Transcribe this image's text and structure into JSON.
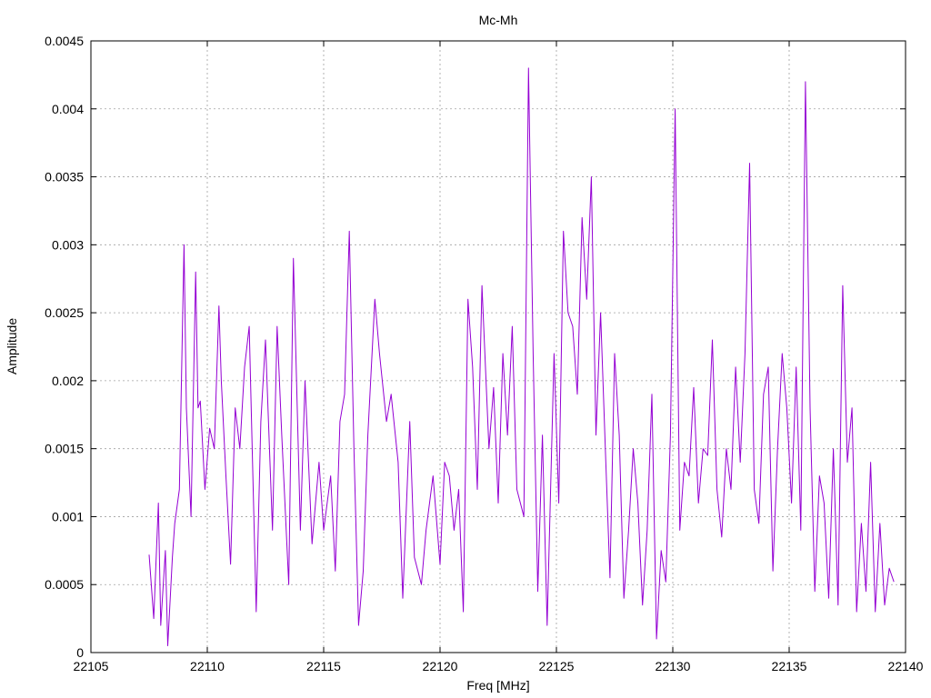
{
  "chart_data": {
    "type": "line",
    "title": "Mc-Mh",
    "xlabel": "Freq [MHz]",
    "ylabel": "Amplitude",
    "xlim": [
      22105,
      22140
    ],
    "ylim": [
      0,
      0.0045
    ],
    "xticks": [
      22105,
      22110,
      22115,
      22120,
      22125,
      22130,
      22135,
      22140
    ],
    "xtick_labels": [
      "22105",
      "22110",
      "22115",
      "22120",
      "22125",
      "22130",
      "22135",
      "22140"
    ],
    "yticks": [
      0,
      0.0005,
      0.001,
      0.0015,
      0.002,
      0.0025,
      0.003,
      0.0035,
      0.004,
      0.0045
    ],
    "ytick_labels": [
      "0",
      "0.0005",
      "0.001",
      "0.0015",
      "0.002",
      "0.0025",
      "0.003",
      "0.0035",
      "0.004",
      "0.0045"
    ],
    "grid": true,
    "color": "#9400d3",
    "series": [
      {
        "x": [
          22107.5,
          22107.7,
          22107.9,
          22108.0,
          22108.2,
          22108.3,
          22108.5,
          22108.6,
          22108.8,
          22109.0,
          22109.1,
          22109.3,
          22109.5,
          22109.6,
          22109.7,
          22109.9,
          22110.1,
          22110.3,
          22110.5,
          22110.6,
          22110.8,
          22111.0,
          22111.2,
          22111.4,
          22111.6,
          22111.8,
          22112.1,
          22112.3,
          22112.5,
          22112.8,
          22113.0,
          22113.2,
          22113.5,
          22113.7,
          22114.0,
          22114.2,
          22114.5,
          22114.8,
          22115.0,
          22115.3,
          22115.5,
          22115.7,
          22115.9,
          22116.1,
          22116.3,
          22116.5,
          22116.7,
          22116.9,
          22117.2,
          22117.4,
          22117.7,
          22117.9,
          22118.2,
          22118.4,
          22118.7,
          22118.9,
          22119.2,
          22119.4,
          22119.7,
          22120.0,
          22120.2,
          22120.4,
          22120.6,
          22120.8,
          22121.0,
          22121.2,
          22121.4,
          22121.6,
          22121.8,
          22122.1,
          22122.3,
          22122.5,
          22122.7,
          22122.9,
          22123.1,
          22123.3,
          22123.6,
          22123.8,
          22124.0,
          22124.2,
          22124.4,
          22124.6,
          22124.9,
          22125.1,
          22125.3,
          22125.5,
          22125.7,
          22125.9,
          22126.1,
          22126.3,
          22126.5,
          22126.7,
          22126.9,
          22127.1,
          22127.3,
          22127.5,
          22127.7,
          22127.9,
          22128.1,
          22128.3,
          22128.5,
          22128.7,
          22128.9,
          22129.1,
          22129.3,
          22129.5,
          22129.7,
          22129.9,
          22130.1,
          22130.3,
          22130.5,
          22130.7,
          22130.9,
          22131.1,
          22131.3,
          22131.5,
          22131.7,
          22131.9,
          22132.1,
          22132.3,
          22132.5,
          22132.7,
          22132.9,
          22133.1,
          22133.3,
          22133.5,
          22133.7,
          22133.9,
          22134.1,
          22134.3,
          22134.5,
          22134.7,
          22134.9,
          22135.1,
          22135.3,
          22135.5,
          22135.7,
          22135.9,
          22136.1,
          22136.3,
          22136.5,
          22136.7,
          22136.9,
          22137.1,
          22137.3,
          22137.5,
          22137.7,
          22137.9,
          22138.1,
          22138.3,
          22138.5,
          22138.7,
          22138.9,
          22139.1,
          22139.3,
          22139.5
        ],
        "y": [
          0.00072,
          0.00025,
          0.0011,
          0.0002,
          0.00075,
          5e-05,
          0.0007,
          0.00095,
          0.0012,
          0.003,
          0.0018,
          0.001,
          0.0028,
          0.0018,
          0.00185,
          0.0012,
          0.00165,
          0.0015,
          0.00255,
          0.002,
          0.0013,
          0.00065,
          0.0018,
          0.0015,
          0.0021,
          0.0024,
          0.0003,
          0.0017,
          0.0023,
          0.0009,
          0.0024,
          0.0016,
          0.0005,
          0.0029,
          0.0009,
          0.002,
          0.0008,
          0.0014,
          0.0009,
          0.0013,
          0.0006,
          0.0017,
          0.0019,
          0.0031,
          0.0015,
          0.0002,
          0.0006,
          0.0016,
          0.0026,
          0.0022,
          0.0017,
          0.0019,
          0.0014,
          0.0004,
          0.0017,
          0.0007,
          0.0005,
          0.0009,
          0.0013,
          0.00065,
          0.0014,
          0.0013,
          0.0009,
          0.0012,
          0.0003,
          0.0026,
          0.0021,
          0.0012,
          0.0027,
          0.0015,
          0.00195,
          0.0011,
          0.0022,
          0.0016,
          0.0024,
          0.0012,
          0.001,
          0.0043,
          0.0022,
          0.00045,
          0.0016,
          0.0002,
          0.0022,
          0.0011,
          0.0031,
          0.0025,
          0.0024,
          0.0019,
          0.0032,
          0.0026,
          0.0035,
          0.0016,
          0.0025,
          0.0015,
          0.00055,
          0.0022,
          0.0016,
          0.0004,
          0.0009,
          0.0015,
          0.0011,
          0.00035,
          0.0009,
          0.0019,
          0.0001,
          0.00075,
          0.00052,
          0.0016,
          0.004,
          0.0009,
          0.0014,
          0.0013,
          0.00195,
          0.0011,
          0.0015,
          0.00145,
          0.0023,
          0.0012,
          0.00085,
          0.0015,
          0.0012,
          0.0021,
          0.0014,
          0.0022,
          0.0036,
          0.0012,
          0.00095,
          0.0019,
          0.0021,
          0.0006,
          0.0015,
          0.0022,
          0.0018,
          0.0011,
          0.0021,
          0.0009,
          0.0042,
          0.0018,
          0.00045,
          0.0013,
          0.0011,
          0.0004,
          0.0015,
          0.00035,
          0.0027,
          0.0014,
          0.0018,
          0.0003,
          0.00095,
          0.00045,
          0.0014,
          0.0003,
          0.00095,
          0.00035,
          0.00062,
          0.00052
        ]
      }
    ]
  }
}
